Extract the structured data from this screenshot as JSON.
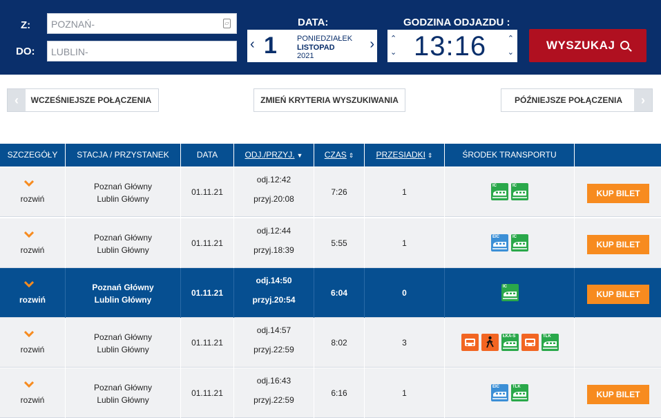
{
  "search": {
    "from_label": "Z:",
    "from_value": "POZNAŃ-",
    "to_label": "DO:",
    "to_value": "LUBLIN-",
    "date_title": "DATA:",
    "date_day": "1",
    "date_weekday": "PONIEDZIAŁEK",
    "date_month": "LISTOPAD",
    "date_year": "2021",
    "time_title": "GODZINA ODJAZDU :",
    "time_value": "13:16",
    "search_label": "WYSZUKAJ"
  },
  "nav": {
    "earlier": "WCZEŚNIEJSZE POŁĄCZENIA",
    "change": "ZMIEŃ KRYTERIA WYSZUKIWANIA",
    "later": "PÓŹNIEJSZE POŁĄCZENIA"
  },
  "table": {
    "headers": {
      "details": "SZCZEGÓŁY",
      "station": "STACJA / PRZYSTANEK",
      "date": "DATA",
      "depart": "ODJ./PRZYJ.",
      "time": "CZAS",
      "transfers": "PRZESIADKI",
      "transport": "ŚRODEK TRANSPORTU"
    },
    "expand_label": "rozwiń",
    "buy_label": "KUP BILET",
    "rows": [
      {
        "from": "Poznań Główny",
        "to": "Lublin Główny",
        "date": "01.11.21",
        "dep": "odj.12:42",
        "arr": "przyj.20:08",
        "duration": "7:26",
        "transfers": "1",
        "icons": [
          "IC",
          "IC"
        ],
        "buy": true
      },
      {
        "from": "Poznań Główny",
        "to": "Lublin Główny",
        "date": "01.11.21",
        "dep": "odj.12:44",
        "arr": "przyj.18:39",
        "duration": "5:55",
        "transfers": "1",
        "icons": [
          "EIC",
          "IC"
        ],
        "buy": true
      },
      {
        "from": "Poznań Główny",
        "to": "Lublin Główny",
        "date": "01.11.21",
        "dep": "odj.14:50",
        "arr": "przyj.20:54",
        "duration": "6:04",
        "transfers": "0",
        "icons": [
          "IC"
        ],
        "buy": true
      },
      {
        "from": "Poznań Główny",
        "to": "Lublin Główny",
        "date": "01.11.21",
        "dep": "odj.14:57",
        "arr": "przyj.22:59",
        "duration": "8:02",
        "transfers": "3",
        "icons": [
          "BUS",
          "WALK",
          "ŁKA-S",
          "BUS",
          "TLK"
        ],
        "buy": false
      },
      {
        "from": "Poznań Główny",
        "to": "Lublin Główny",
        "date": "01.11.21",
        "dep": "odj.16:43",
        "arr": "przyj.22:59",
        "duration": "6:16",
        "transfers": "1",
        "icons": [
          "EIC",
          "TLK"
        ],
        "buy": true
      }
    ]
  },
  "colors": {
    "navy": "#0a2f6b",
    "header_blue": "#064f91",
    "search_red": "#b01020",
    "buy_orange": "#f78b1f",
    "ic_green": "#2aa84a",
    "eic_blue": "#3b8fd6",
    "bus_orange": "#f26522"
  }
}
